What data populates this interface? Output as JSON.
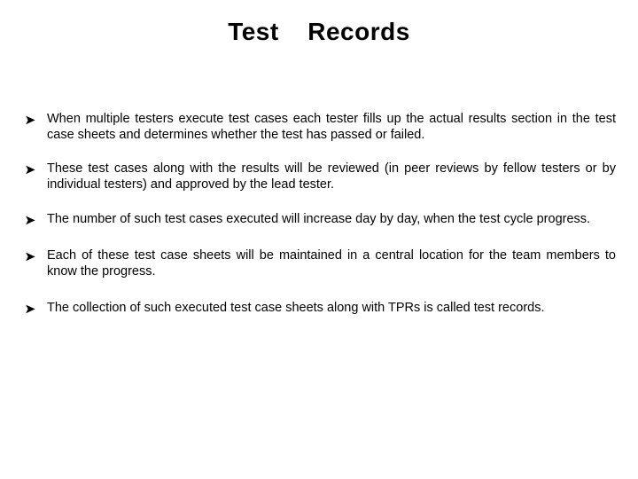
{
  "slide": {
    "title": "Test  Records",
    "background_color": "#ffffff",
    "text_color": "#000000",
    "bullet_glyph_name": "arrowhead-right-bullet",
    "bullets": [
      {
        "id": "bullet-1",
        "text": "When multiple testers execute test cases each tester fills up the actual results section in the test case sheets and determines whether the test has passed or failed."
      },
      {
        "id": "bullet-2",
        "text": "These test cases along with the results will be reviewed (in peer reviews by fellow testers or by individual testers) and approved by the lead tester."
      },
      {
        "id": "bullet-3",
        "text": "The number of such test cases executed will increase day by day, when the test cycle progress."
      },
      {
        "id": "bullet-4",
        "text": "Each of these test case sheets will be maintained in a central location for the team members to know the progress."
      },
      {
        "id": "bullet-5",
        "text": "The collection of such executed test case sheets along with TPRs is called test records."
      }
    ]
  }
}
